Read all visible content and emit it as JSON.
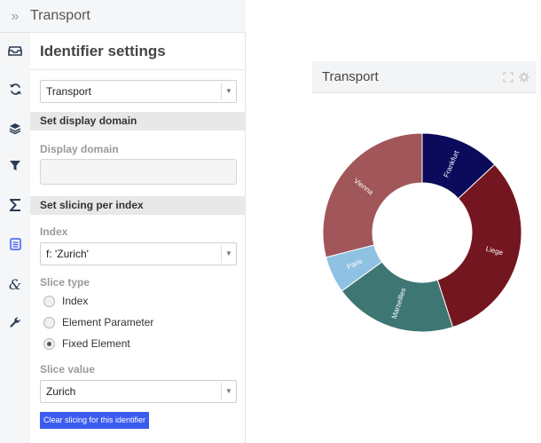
{
  "panel": {
    "header_title": "Transport",
    "title": "Identifier settings",
    "identifier_select": "Transport",
    "section_display_domain": "Set display domain",
    "display_domain_label": "Display domain",
    "display_domain_value": "",
    "section_slicing": "Set slicing per index",
    "index_label": "Index",
    "index_select": "f: 'Zurich'",
    "slice_type_label": "Slice type",
    "slice_types": [
      {
        "label": "Index",
        "checked": false
      },
      {
        "label": "Element Parameter",
        "checked": false
      },
      {
        "label": "Fixed Element",
        "checked": true
      }
    ],
    "slice_value_label": "Slice value",
    "slice_value_select": "Zurich",
    "clear_button": "Clear slicing for this identifier"
  },
  "rail_icons": [
    "table-icon",
    "refresh-icon",
    "layers-icon",
    "filter-icon",
    "sigma-icon",
    "list-icon",
    "ampersand-icon",
    "wrench-icon"
  ],
  "widget": {
    "title": "Transport",
    "tools": [
      "expand-icon",
      "gear-icon"
    ]
  },
  "chart_data": {
    "type": "pie",
    "donut": true,
    "slices": [
      {
        "label": "Frankfurt",
        "value": 13,
        "color": "#0c0a5a"
      },
      {
        "label": "Liege",
        "value": 32,
        "color": "#74161f"
      },
      {
        "label": "Marseilles",
        "value": 20,
        "color": "#3e7674"
      },
      {
        "label": "Paris",
        "value": 6,
        "color": "#8fc1e3"
      },
      {
        "label": "Vienna",
        "value": 29,
        "color": "#a15659"
      }
    ],
    "start_angle_deg": 0
  }
}
